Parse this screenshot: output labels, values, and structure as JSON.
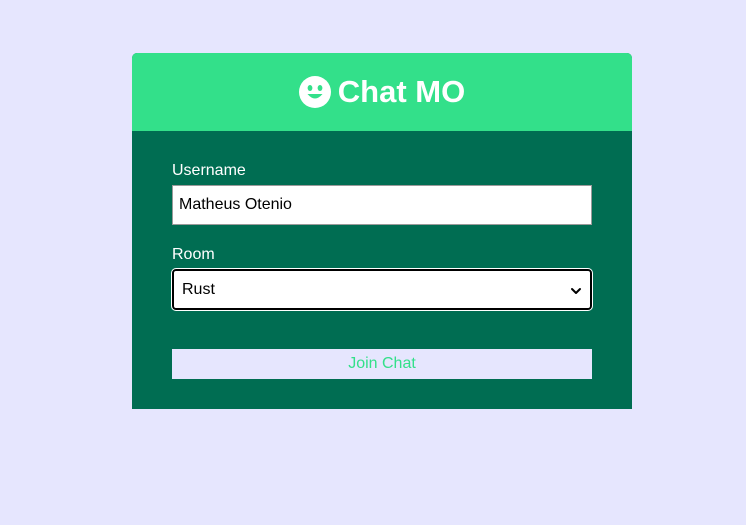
{
  "header": {
    "icon": "smiley-face-icon",
    "title": "Chat MO",
    "background_color": "#33e08a"
  },
  "form": {
    "background_color": "#006d52",
    "username": {
      "label": "Username",
      "value": "Matheus Otenio"
    },
    "room": {
      "label": "Room",
      "selected": "Rust",
      "icon": "chevron-down-icon"
    },
    "join_button": {
      "label": "Join Chat",
      "text_color": "#33e08a"
    }
  },
  "page": {
    "background_color": "#e6e6fe"
  }
}
